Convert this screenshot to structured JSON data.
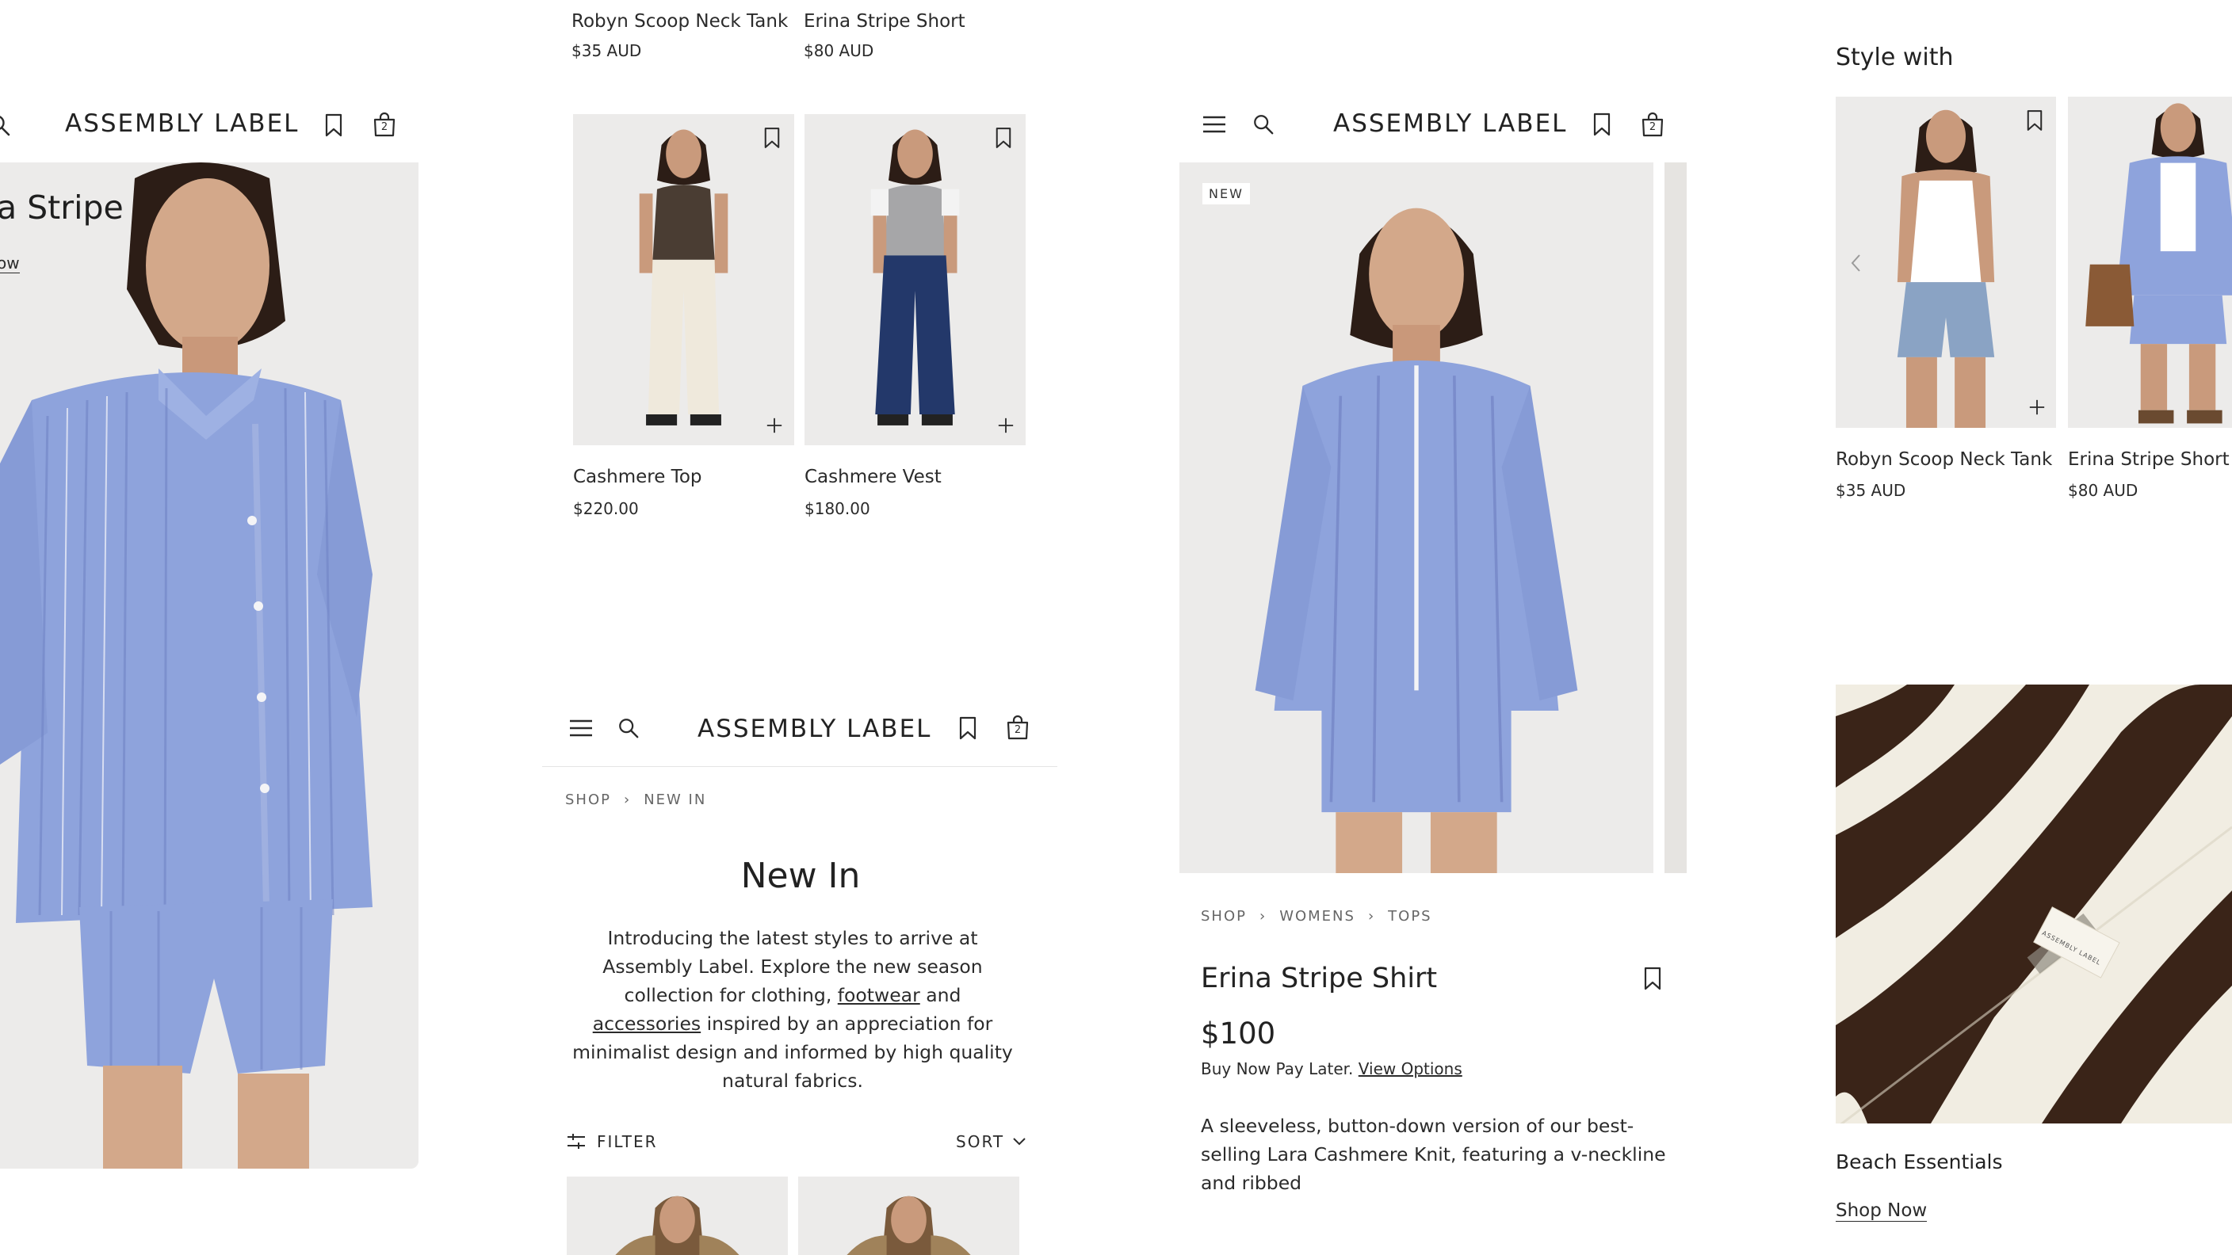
{
  "brand": "ASSEMBLY LABEL",
  "colors": {
    "shirt_blue": "#8ea3dc",
    "photo_bg": "#ecebea",
    "text": "#2b2b2b",
    "muted": "#666666",
    "towel_brown": "#3a2418",
    "towel_cream": "#f1ede2"
  },
  "icons": {
    "menu": "hamburger-menu",
    "search": "magnifier",
    "wishlist": "bookmark",
    "cart": "shopping-bag"
  },
  "cart_count": "2",
  "panel_hero": {
    "title_partial": "a Stripe",
    "link_partial": "ow"
  },
  "panel_products": {
    "top_row": [
      {
        "name": "Robyn Scoop Neck Tank",
        "price": "$35 AUD"
      },
      {
        "name": "Erina Stripe Short",
        "price": "$80 AUD"
      }
    ],
    "cards": [
      {
        "name": "Cashmere Top",
        "price": "$220.00"
      },
      {
        "name": "Cashmere Vest",
        "price": "$180.00"
      }
    ]
  },
  "panel_new_in": {
    "breadcrumb": [
      "SHOP",
      "NEW IN"
    ],
    "title": "New In",
    "intro_part1": "Introducing the latest styles to arrive at Assembly Label. Explore the new season collection for clothing, ",
    "link_footwear": "footwear",
    "intro_and": " and ",
    "link_accessories": "accessories",
    "intro_part2": " inspired by an appreciation for minimalist design and informed by high quality natural fabrics.",
    "filter_label": "FILTER",
    "sort_label": "SORT"
  },
  "panel_product": {
    "badge": "NEW",
    "breadcrumb": [
      "SHOP",
      "WOMENS",
      "TOPS"
    ],
    "name": "Erina Stripe Shirt",
    "price": "$100",
    "bnpl_text": "Buy Now Pay Later.",
    "bnpl_link": "View Options",
    "description": "A sleeveless, button-down version of our best-selling Lara Cashmere Knit, featuring a v-neckline and ribbed"
  },
  "panel_style_with": {
    "heading": "Style with",
    "items": [
      {
        "name": "Robyn Scoop Neck Tank",
        "price": "$35 AUD"
      },
      {
        "name": "Erina Stripe Short",
        "price": "$80 AUD"
      }
    ],
    "collection_title": "Beach Essentials",
    "collection_link": "Shop Now",
    "towel_tag": "ASSEMBLY LABEL"
  }
}
